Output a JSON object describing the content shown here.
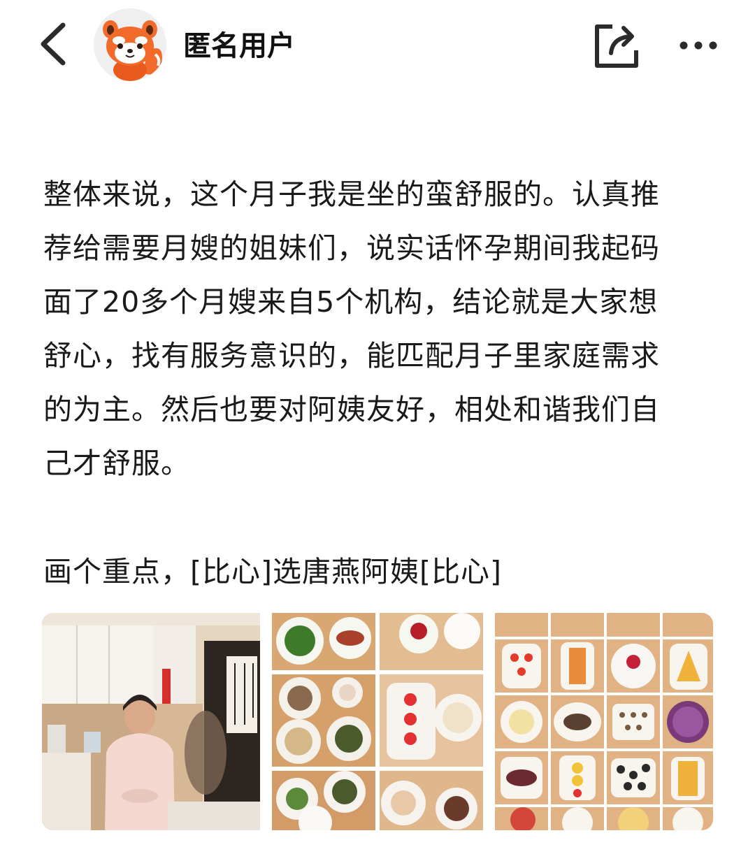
{
  "header": {
    "username": "匿名用户",
    "back_icon": "chevron-left-icon",
    "share_icon": "share-icon",
    "more_icon": "more-icon"
  },
  "post": {
    "body": "整体来说，这个月子我是坐的蛮舒服的。认真推\n荐给需要月嫂的姐妹们，说实话怀孕期间我起码\n面了20多个月嫂来自5个机构，结论就是大家想\n舒心，找有服务意识的，能匹配月子里家庭需求\n的为主。然后也要对阿姨友好，相处和谐我们自\n己才舒服。",
    "highlight": "画个重点，[比心]选唐燕阿姨[比心]"
  },
  "images": {
    "count": 3
  },
  "colors": {
    "accent": "#f26b2a",
    "text": "#1a1a1a",
    "icon": "#333333"
  }
}
